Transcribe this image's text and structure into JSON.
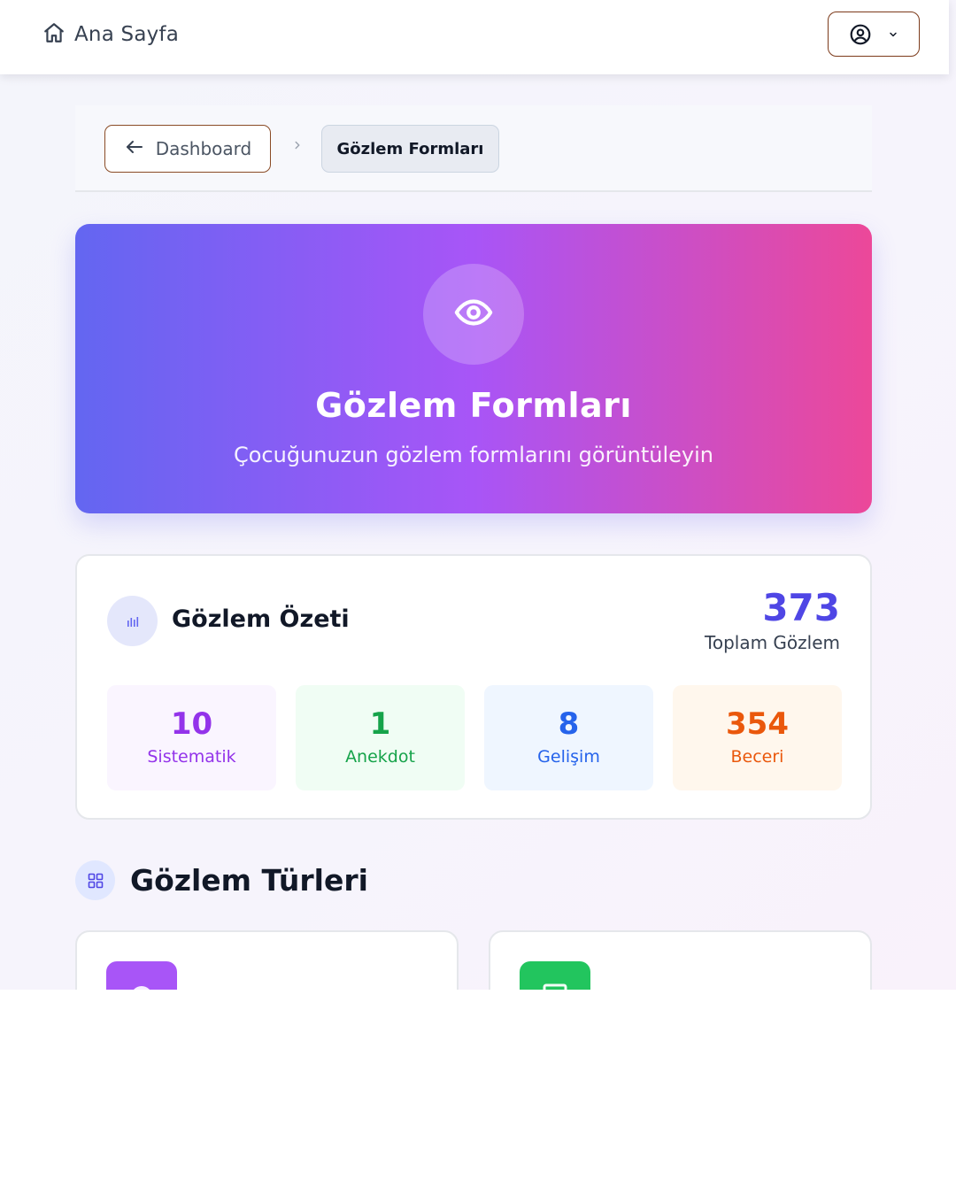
{
  "header": {
    "home_label": "Ana Sayfa",
    "home_icon": "home-icon",
    "user_icon": "user-circle-icon",
    "dropdown_icon": "chevron-down-icon"
  },
  "breadcrumb": {
    "back_label": "Dashboard",
    "separator_icon": "chevron-right-icon",
    "current_label": "Gözlem Formları"
  },
  "hero": {
    "icon": "eye-icon",
    "title": "Gözlem Formları",
    "subtitle": "Çocuğunuzun gözlem formlarını görüntüleyin",
    "gradient": [
      "#6366f1",
      "#a855f7",
      "#ec4899"
    ]
  },
  "summary": {
    "icon": "bar-chart-icon",
    "title": "Gözlem Özeti",
    "total_value": "373",
    "total_label": "Toplam Gözlem",
    "stats": [
      {
        "value": "10",
        "label": "Sistematik",
        "color": "#9333ea",
        "bg": "#faf5ff"
      },
      {
        "value": "1",
        "label": "Anekdot",
        "color": "#16a34a",
        "bg": "#f0fdf4"
      },
      {
        "value": "8",
        "label": "Gelişim",
        "color": "#2563eb",
        "bg": "#eff6ff"
      },
      {
        "value": "354",
        "label": "Beceri",
        "color": "#ea580c",
        "bg": "#fff7ed"
      }
    ]
  },
  "section": {
    "icon": "grid-icon",
    "title": "Gözlem Türleri"
  },
  "type_cards": [
    {
      "icon_color": "#a855f7"
    },
    {
      "icon_color": "#22c55e"
    }
  ]
}
